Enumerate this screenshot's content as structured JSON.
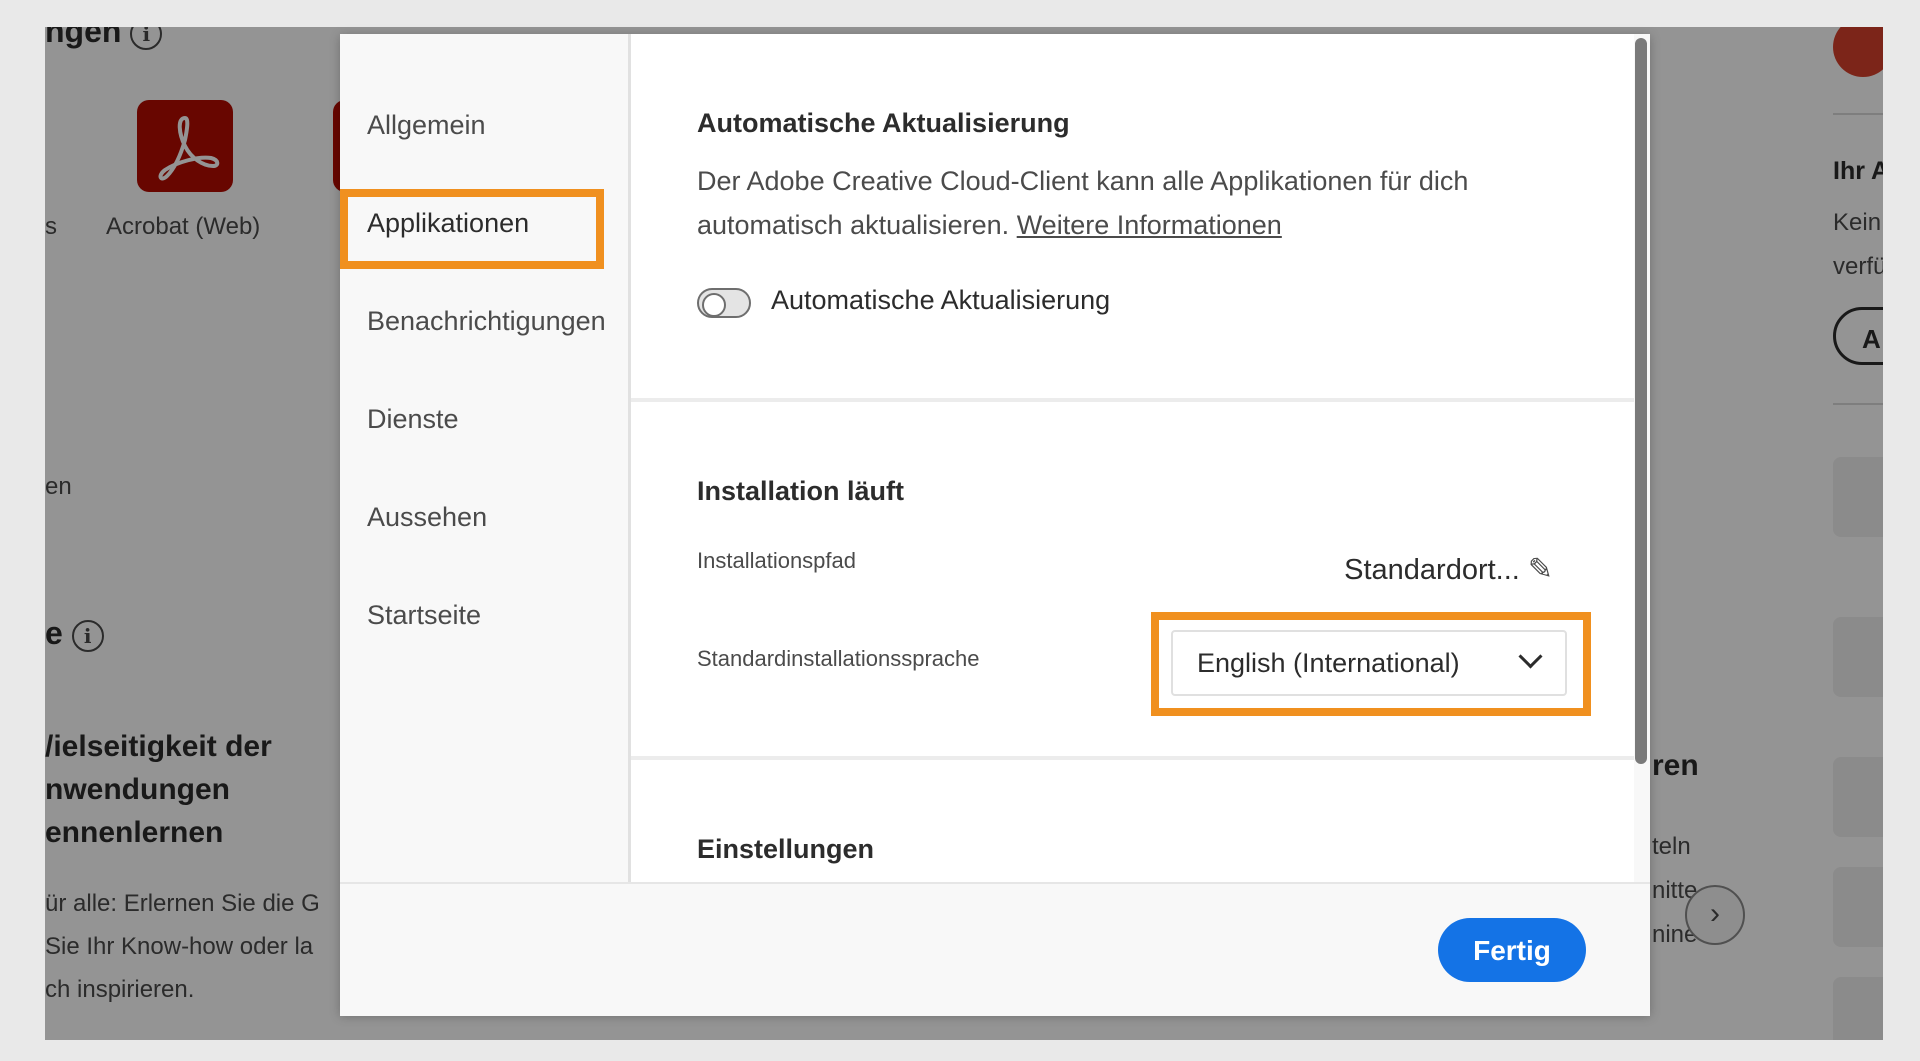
{
  "background": {
    "heading_fragment": "ngen",
    "app_label_fragment": "s",
    "app_label": "Acrobat (Web)",
    "side_fragment": "en",
    "section_fragment": "e",
    "card_title_lines": [
      "/ielseitigkeit der",
      "\nnwendungen",
      "\nennenlernen"
    ],
    "card_text_lines": [
      "ür alle: Erlernen Sie die G",
      "Sie Ihr Know-how oder la",
      "ch inspirieren."
    ],
    "right_card_fragments": [
      "ren",
      "teln",
      "nitte",
      "nine"
    ],
    "right_panel_title": "Ihr A",
    "right_panel_text": [
      "Kein",
      "verfü"
    ],
    "right_panel_button": "A"
  },
  "sidebar": {
    "items": [
      {
        "label": "Allgemein"
      },
      {
        "label": "Applikationen",
        "active": true
      },
      {
        "label": "Benachrichtigungen"
      },
      {
        "label": "Dienste"
      },
      {
        "label": "Aussehen"
      },
      {
        "label": "Startseite"
      }
    ]
  },
  "auto_update": {
    "title": "Automatische Aktualisierung",
    "description": "Der Adobe Creative Cloud-Client kann alle Applikationen für dich automatisch aktualisieren.",
    "link": "Weitere Informationen",
    "toggle_label": "Automatische Aktualisierung"
  },
  "install": {
    "title": "Installation läuft",
    "path_label": "Installationspfad",
    "path_value": "Standardort...",
    "language_label": "Standardinstallationssprache",
    "language_value": "English (International)"
  },
  "settings": {
    "title": "Einstellungen"
  },
  "footer": {
    "done_label": "Fertig"
  },
  "colors": {
    "highlight": "#f0901f",
    "primary_button": "#1473e6",
    "acrobat_red": "#b30b00"
  }
}
